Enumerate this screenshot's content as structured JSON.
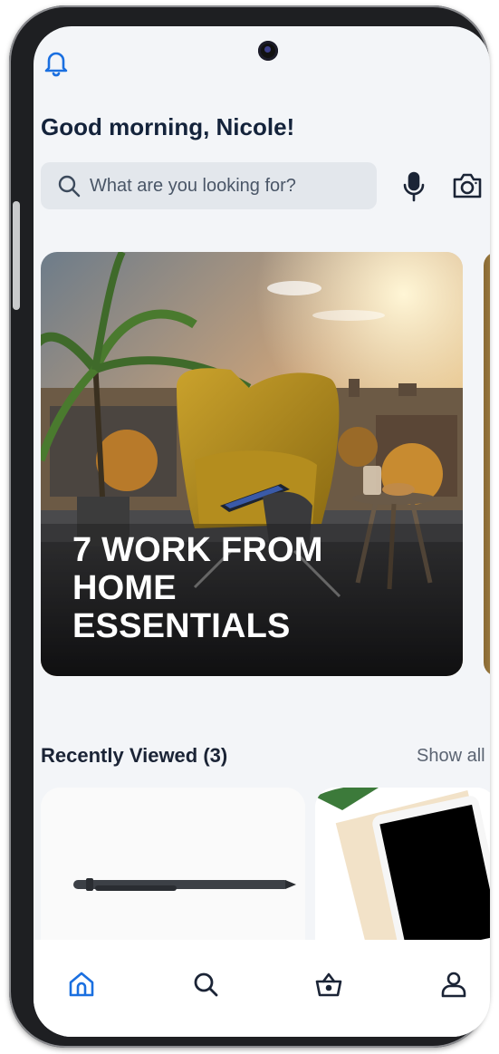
{
  "header": {
    "greeting": "Good morning, Nicole!"
  },
  "search": {
    "placeholder": "What are you looking for?"
  },
  "icons": {
    "notifications": "bell-icon",
    "search": "search-icon",
    "voice": "microphone-icon",
    "camera": "camera-icon"
  },
  "banner": {
    "title": "7 WORK FROM HOME ESSENTIALS"
  },
  "recently_viewed": {
    "title": "Recently Viewed (3)",
    "show_all": "Show all"
  },
  "nav": {
    "items": [
      "home-icon",
      "search-icon",
      "basket-icon",
      "user-icon"
    ],
    "active": "home"
  },
  "colors": {
    "accent": "#1a6fe0",
    "text": "#14233b",
    "background": "#f3f5f8"
  }
}
